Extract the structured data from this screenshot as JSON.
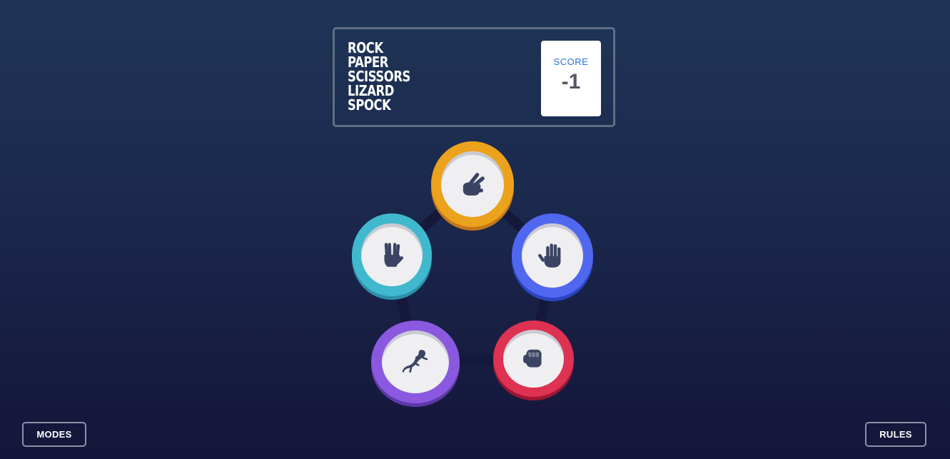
{
  "header": {
    "title_lines": [
      "ROCK",
      "PAPER",
      "SCISSORS",
      "LIZARD",
      "SPOCK"
    ],
    "score_label": "SCORE",
    "score_value": "-1"
  },
  "tokens": [
    {
      "id": "scissors",
      "icon": "scissors-hand-icon",
      "color": "#eba21c"
    },
    {
      "id": "paper",
      "icon": "paper-hand-icon",
      "color": "#5067ef"
    },
    {
      "id": "rock",
      "icon": "rock-fist-icon",
      "color": "#dd3251"
    },
    {
      "id": "lizard",
      "icon": "lizard-icon",
      "color": "#8b58e0"
    },
    {
      "id": "spock",
      "icon": "spock-hand-icon",
      "color": "#40b9ce"
    }
  ],
  "buttons": {
    "modes_label": "MODES",
    "rules_label": "RULES"
  },
  "colors": {
    "background_top": "#1f3557",
    "background_bottom": "#141539",
    "icon_fill": "#3b4363"
  }
}
